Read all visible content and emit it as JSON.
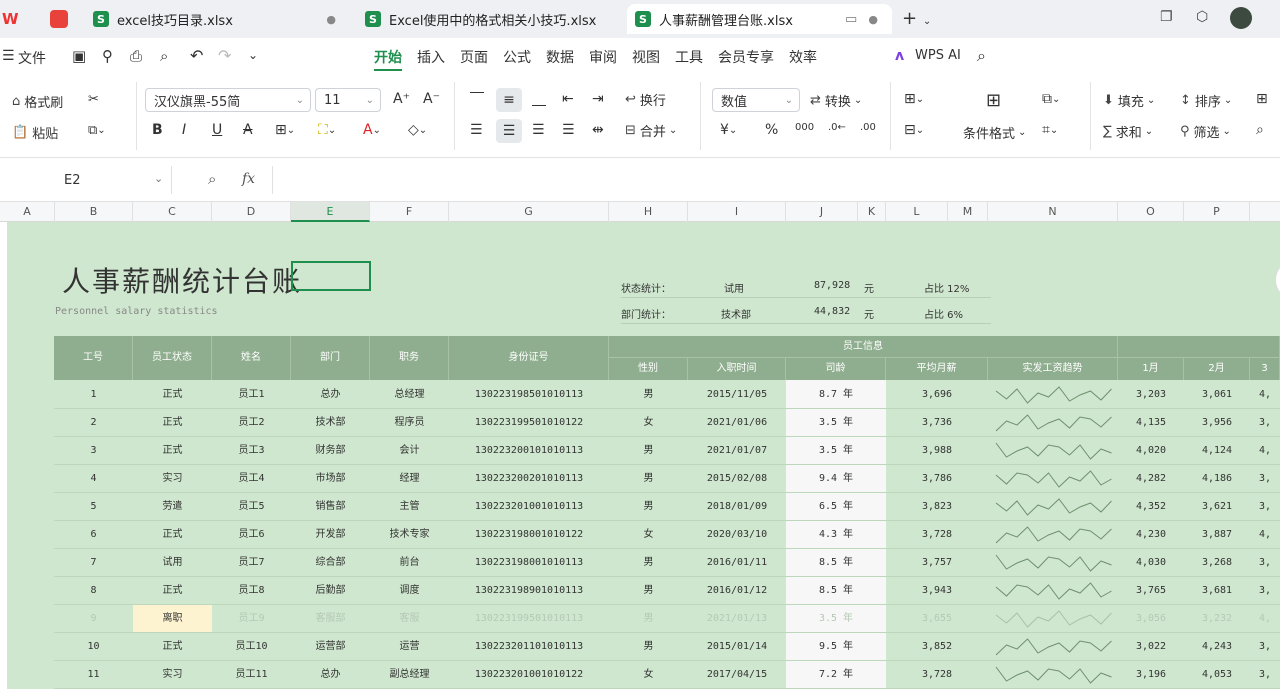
{
  "tabs": [
    {
      "label": "excel技巧目录.xlsx"
    },
    {
      "label": "Excel使用中的格式相关小技巧.xlsx"
    },
    {
      "label": "人事薪酬管理台账.xlsx"
    }
  ],
  "menu": {
    "file": "文件",
    "items": [
      "开始",
      "插入",
      "页面",
      "公式",
      "数据",
      "审阅",
      "视图",
      "工具",
      "会员专享",
      "效率"
    ],
    "wps_ai": "WPS AI"
  },
  "ribbon": {
    "format_painter": "格式刷",
    "paste": "粘贴",
    "font": "汉仪旗黑-55简",
    "font_size": "11",
    "wrap": "换行",
    "merge": "合并",
    "number_format": "数值",
    "convert": "转换",
    "cond_format": "条件格式",
    "fill": "填充",
    "sort": "排序",
    "sum": "求和",
    "filter": "筛选"
  },
  "formula_bar": {
    "cell_ref": "E2",
    "fx": "fx",
    "value": ""
  },
  "columns": [
    "A",
    "B",
    "C",
    "D",
    "E",
    "F",
    "G",
    "H",
    "I",
    "J",
    "K",
    "L",
    "M",
    "N",
    "O",
    "P"
  ],
  "sheet": {
    "title": "人事薪酬统计台账",
    "subtitle": "Personnel salary statistics",
    "stats": [
      {
        "label": "状态统计：",
        "name": "试用",
        "amount": "87,928",
        "unit": "元",
        "ratio": "占比 12%"
      },
      {
        "label": "部门统计：",
        "name": "技术部",
        "amount": "44,832",
        "unit": "元",
        "ratio": "占比 6%"
      }
    ],
    "group_header": "员工信息",
    "headers": [
      "工号",
      "员工状态",
      "姓名",
      "部门",
      "职务",
      "身份证号",
      "性别",
      "入职时间",
      "司龄",
      "平均月薪",
      "实发工资趋势",
      "1月",
      "2月"
    ],
    "rows": [
      {
        "id": "1",
        "status": "正式",
        "name": "员工1",
        "dept": "总办",
        "title": "总经理",
        "idno": "130223198501010113",
        "sex": "男",
        "date": "2015/11/05",
        "tenure": "8.7 年",
        "avg": "3,696",
        "m1": "3,203",
        "m2": "3,061",
        "m3": "4,"
      },
      {
        "id": "2",
        "status": "正式",
        "name": "员工2",
        "dept": "技术部",
        "title": "程序员",
        "idno": "130223199501010122",
        "sex": "女",
        "date": "2021/01/06",
        "tenure": "3.5 年",
        "avg": "3,736",
        "m1": "4,135",
        "m2": "3,956",
        "m3": "3,"
      },
      {
        "id": "3",
        "status": "正式",
        "name": "员工3",
        "dept": "财务部",
        "title": "会计",
        "idno": "130223200101010113",
        "sex": "男",
        "date": "2021/01/07",
        "tenure": "3.5 年",
        "avg": "3,988",
        "m1": "4,020",
        "m2": "4,124",
        "m3": "4,"
      },
      {
        "id": "4",
        "status": "实习",
        "name": "员工4",
        "dept": "市场部",
        "title": "经理",
        "idno": "130223200201010113",
        "sex": "男",
        "date": "2015/02/08",
        "tenure": "9.4 年",
        "avg": "3,786",
        "m1": "4,282",
        "m2": "4,186",
        "m3": "3,"
      },
      {
        "id": "5",
        "status": "劳遣",
        "name": "员工5",
        "dept": "销售部",
        "title": "主管",
        "idno": "130223201001010113",
        "sex": "男",
        "date": "2018/01/09",
        "tenure": "6.5 年",
        "avg": "3,823",
        "m1": "4,352",
        "m2": "3,621",
        "m3": "3,"
      },
      {
        "id": "6",
        "status": "正式",
        "name": "员工6",
        "dept": "开发部",
        "title": "技术专家",
        "idno": "130223198001010122",
        "sex": "女",
        "date": "2020/03/10",
        "tenure": "4.3 年",
        "avg": "3,728",
        "m1": "4,230",
        "m2": "3,887",
        "m3": "4,"
      },
      {
        "id": "7",
        "status": "试用",
        "name": "员工7",
        "dept": "综合部",
        "title": "前台",
        "idno": "130223198001010113",
        "sex": "男",
        "date": "2016/01/11",
        "tenure": "8.5 年",
        "avg": "3,757",
        "m1": "4,030",
        "m2": "3,268",
        "m3": "3,"
      },
      {
        "id": "8",
        "status": "正式",
        "name": "员工8",
        "dept": "后勤部",
        "title": "调度",
        "idno": "130223198901010113",
        "sex": "男",
        "date": "2016/01/12",
        "tenure": "8.5 年",
        "avg": "3,943",
        "m1": "3,765",
        "m2": "3,681",
        "m3": "3,"
      },
      {
        "id": "9",
        "status": "离职",
        "name": "员工9",
        "dept": "客服部",
        "title": "客服",
        "idno": "130223199501010113",
        "sex": "男",
        "date": "2021/01/13",
        "tenure": "3.5 年",
        "avg": "3,655",
        "m1": "3,056",
        "m2": "3,232",
        "m3": "4,"
      },
      {
        "id": "10",
        "status": "正式",
        "name": "员工10",
        "dept": "运营部",
        "title": "运营",
        "idno": "130223201101010113",
        "sex": "男",
        "date": "2015/01/14",
        "tenure": "9.5 年",
        "avg": "3,852",
        "m1": "3,022",
        "m2": "4,243",
        "m3": "3,"
      },
      {
        "id": "11",
        "status": "实习",
        "name": "员工11",
        "dept": "总办",
        "title": "副总经理",
        "idno": "130223201001010122",
        "sex": "女",
        "date": "2017/04/15",
        "tenure": "7.2 年",
        "avg": "3,728",
        "m1": "3,196",
        "m2": "4,053",
        "m3": "3,"
      }
    ]
  },
  "colors": {
    "brand": "#1f8f4e",
    "sheet_bg": "#cfe7cf",
    "header_bg": "#8fae8f",
    "highlight": "#fdf3d0"
  }
}
